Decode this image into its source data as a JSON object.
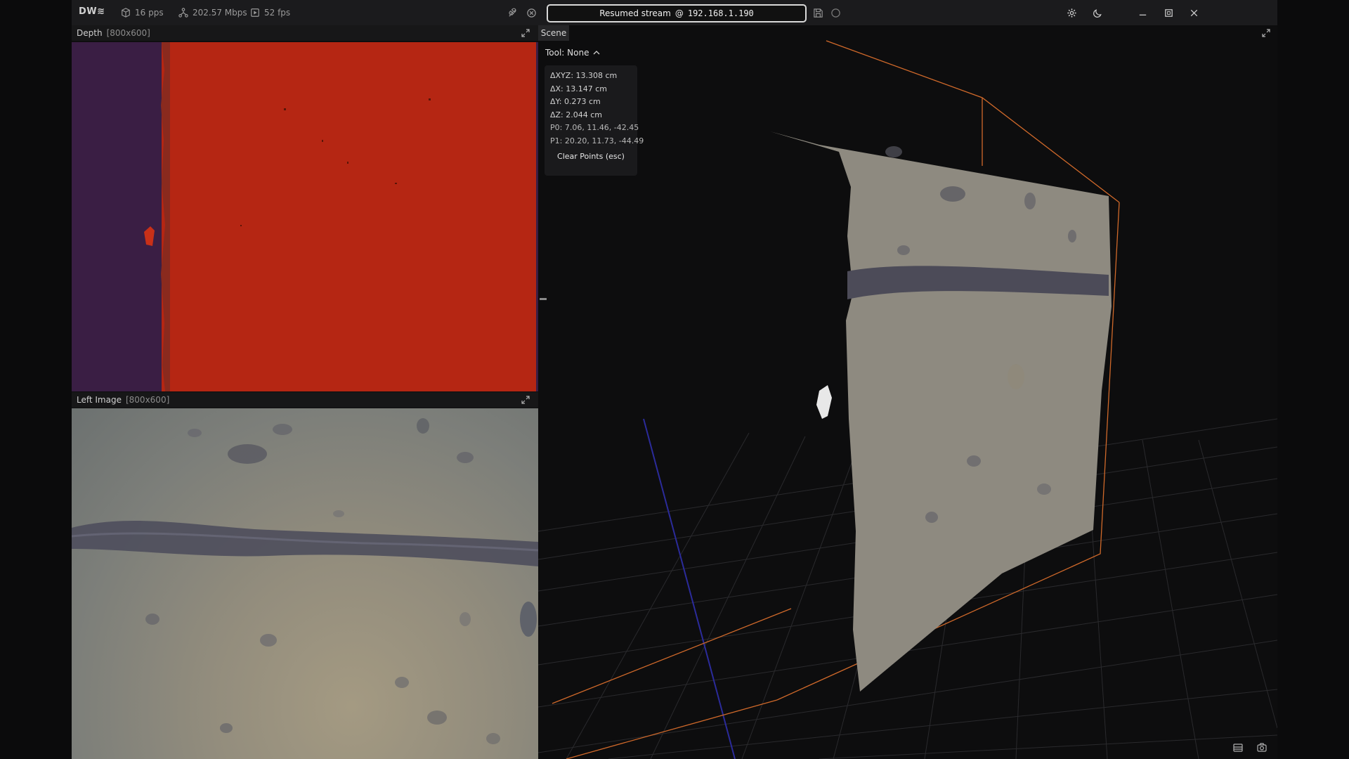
{
  "titlebar": {
    "logo": "DW≋",
    "pps": "16 pps",
    "bandwidth": "202.57 Mbps",
    "fps": "52 fps",
    "stream_status": "Resumed stream",
    "stream_at": "@",
    "stream_ip": "192.168.1.190"
  },
  "depth_panel": {
    "title": "Depth",
    "size": "[800x600]"
  },
  "left_panel": {
    "title": "Left Image",
    "size": "[800x600]"
  },
  "scene": {
    "tab": "Scene",
    "tool_label": "Tool: None",
    "measurements": [
      "ΔXYZ: 13.308 cm",
      "ΔX: 13.147 cm",
      "ΔY: 0.273 cm",
      "ΔZ:  2.044 cm",
      "P0: 7.06, 11.46, -42.45",
      "P1: 20.20, 11.73, -44.49"
    ],
    "clear_button": "Clear Points (esc)"
  },
  "colors": {
    "depth_red": "#b52613",
    "depth_purple": "#3a1e44",
    "box_orange": "#d0692a",
    "grid": "#2a2a2d"
  }
}
